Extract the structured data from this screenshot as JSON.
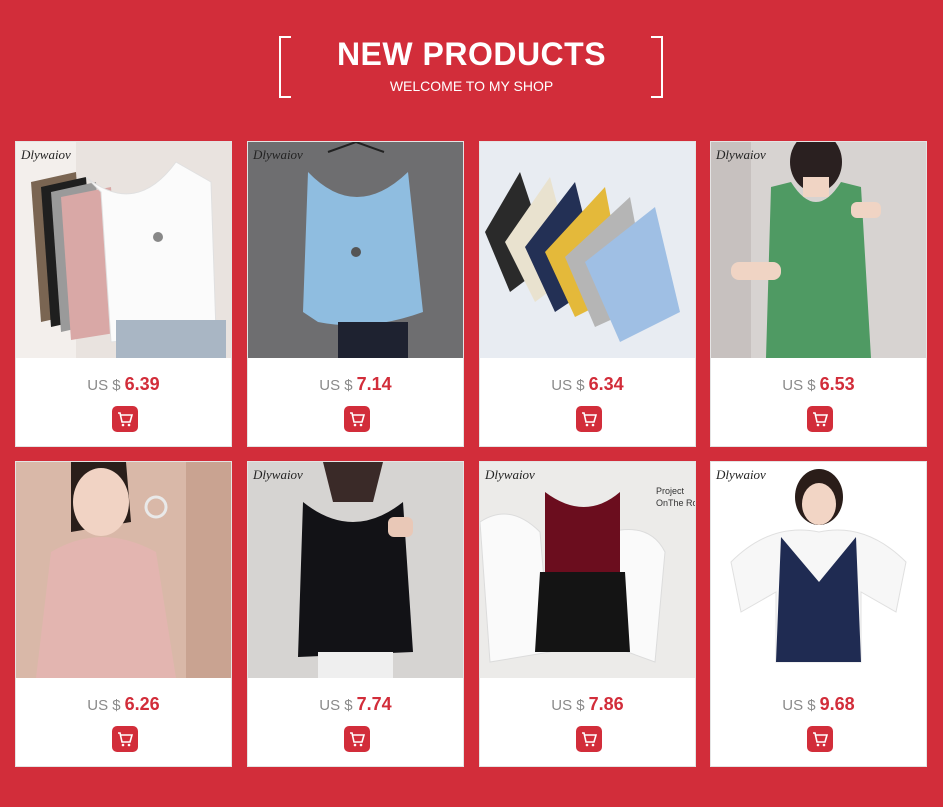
{
  "header": {
    "title": "NEW PRODUCTS",
    "subtitle": "WELCOME TO MY SHOP"
  },
  "colors": {
    "background": "#d22d3a",
    "price": "#d22d3a",
    "card": "#ffffff"
  },
  "products": [
    {
      "brand": "Dlywaiov",
      "currency": "US $",
      "price": "6.39",
      "image": "white-knit-tank-photo"
    },
    {
      "brand": "Dlywaiov",
      "currency": "US $",
      "price": "7.14",
      "image": "light-blue-knit-tank-photo"
    },
    {
      "brand": "",
      "currency": "US $",
      "price": "6.34",
      "image": "multicolor-camisoles-photo"
    },
    {
      "brand": "Dlywaiov",
      "currency": "US $",
      "price": "6.53",
      "image": "green-knit-tank-photo"
    },
    {
      "brand": "",
      "currency": "US $",
      "price": "6.26",
      "image": "pink-mesh-turtleneck-tank-photo"
    },
    {
      "brand": "Dlywaiov",
      "currency": "US $",
      "price": "7.74",
      "image": "black-mesh-tank-photo"
    },
    {
      "brand": "Dlywaiov",
      "currency": "US $",
      "price": "7.86",
      "image": "burgundy-velvet-camisole-photo"
    },
    {
      "brand": "Dlywaiov",
      "currency": "US $",
      "price": "9.68",
      "image": "navy-knit-vest-photo"
    }
  ],
  "photo_texts": {
    "shirt_print": "Project OnThe Ro"
  }
}
